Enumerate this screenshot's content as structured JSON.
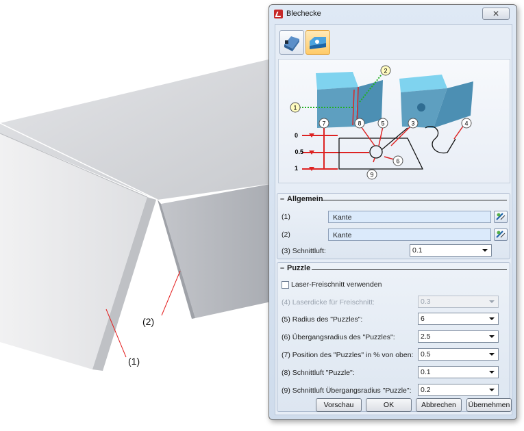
{
  "callouts": {
    "edge1": "(1)",
    "edge2": "(2)"
  },
  "dialog": {
    "title": "Blechecke",
    "close_glyph": "✕",
    "modes": [
      {
        "icon": "corner-closure-icon",
        "active": false
      },
      {
        "icon": "puzzle-corner-icon",
        "active": true
      }
    ]
  },
  "preview": {
    "bubbles": [
      "1",
      "2",
      "7",
      "8",
      "5",
      "3",
      "4",
      "6",
      "9"
    ],
    "scale_labels": [
      "0",
      "0.5",
      "1"
    ]
  },
  "allgemein": {
    "title": "Allgemein",
    "edge1_label": "(1)",
    "edge1_value": "Kante",
    "edge2_label": "(2)",
    "edge2_value": "Kante",
    "gap_label": "(3) Schnittluft:",
    "gap_value": "0.1"
  },
  "puzzle": {
    "title": "Puzzle",
    "laser_label": "Laser-Freischnitt verwenden",
    "laser_checked": false,
    "laser_thickness_label": "(4) Laserdicke für Freischnitt:",
    "laser_thickness_value": "0.3",
    "radius_label": "(5) Radius des \"Puzzles\":",
    "radius_value": "6",
    "transition_radius_label": "(6) Übergangsradius des \"Puzzles\":",
    "transition_radius_value": "2.5",
    "position_label": "(7) Position des \"Puzzles\" in % von oben:",
    "position_value": "0.5",
    "cut_gap_label": "(8) Schnittluft \"Puzzle\":",
    "cut_gap_value": "0.1",
    "cut_gap_transition_label": "(9) Schnittluft Übergangsradius \"Puzzle\":",
    "cut_gap_transition_value": "0.2"
  },
  "buttons": {
    "preview": "Vorschau",
    "ok": "OK",
    "cancel": "Abbrechen",
    "apply": "Übernehmen"
  }
}
